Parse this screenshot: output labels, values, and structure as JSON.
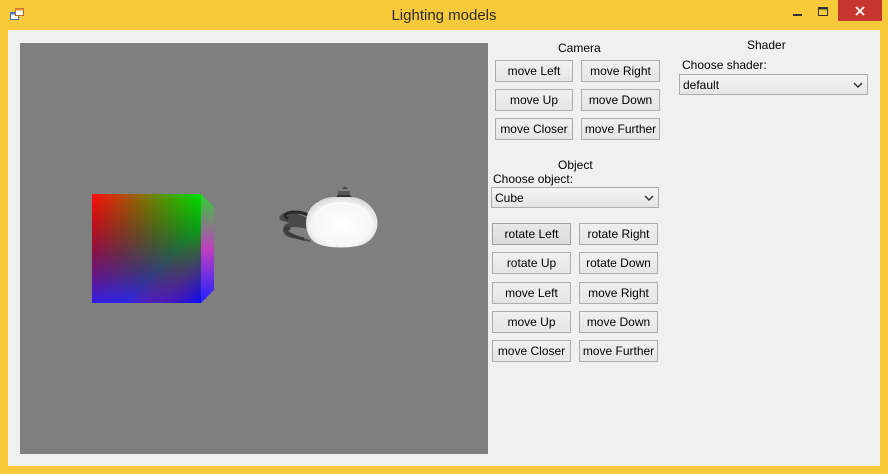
{
  "window": {
    "title": "Lighting models",
    "icon": "winforms-app-icon",
    "controls": [
      "minimize-icon",
      "maximize-icon",
      "close-icon"
    ]
  },
  "colors": {
    "frame": "#f9c93c",
    "client": "#f0f0f0",
    "viewport": "#7f7f7f",
    "close": "#c7372f"
  },
  "viewport": {
    "scene_objects": [
      "gradient-cube",
      "teapot"
    ]
  },
  "camera": {
    "heading": "Camera",
    "move_left": "move Left",
    "move_right": "move Right",
    "move_up": "move Up",
    "move_down": "move Down",
    "move_closer": "move Closer",
    "move_further": "move Further"
  },
  "shader": {
    "heading": "Shader",
    "choose_label": "Choose shader:",
    "selected": "default"
  },
  "object": {
    "heading": "Object",
    "choose_label": "Choose object:",
    "selected": "Cube",
    "rotate_left": "rotate Left",
    "rotate_right": "rotate Right",
    "rotate_up": "rotate Up",
    "rotate_down": "rotate Down",
    "move_left": "move Left",
    "move_right": "move Right",
    "move_up": "move Up",
    "move_down": "move Down",
    "move_closer": "move Closer",
    "move_further": "move Further"
  }
}
